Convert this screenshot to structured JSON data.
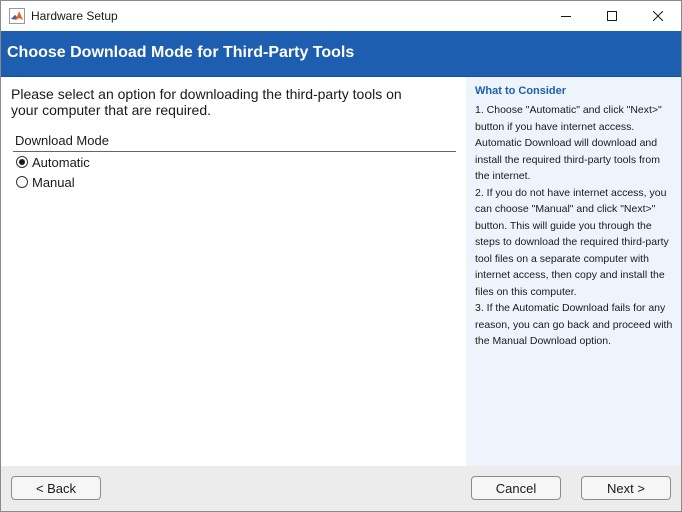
{
  "window": {
    "title": "Hardware Setup",
    "app_icon": "matlab-logo-icon",
    "controls": [
      "minimize-icon",
      "maximize-icon",
      "close-icon"
    ]
  },
  "header": {
    "title": "Choose Download Mode for Third-Party Tools",
    "color": "#1e5eb1"
  },
  "main": {
    "prompt": "Please select an option for downloading the third-party tools on your computer that are required.",
    "group_label": "Download Mode",
    "options": [
      {
        "label": "Automatic",
        "selected": true
      },
      {
        "label": "Manual",
        "selected": false
      }
    ]
  },
  "side": {
    "title": "What to Consider",
    "paragraphs": [
      "1. Choose \"Automatic\" and click \"Next>\" button if you have internet access. Automatic Download will download and install the required third-party tools from the internet.",
      "2. If you do not have internet access, you can choose \"Manual\" and click \"Next>\" button. This will guide you through the steps to download the required third-party tool files on a separate computer with internet access, then copy and install the files on this computer.",
      "3. If the Automatic Download fails for any reason, you can go back and proceed with the Manual Download option."
    ]
  },
  "footer": {
    "back_label": "< Back",
    "cancel_label": "Cancel",
    "next_label": "Next >"
  }
}
